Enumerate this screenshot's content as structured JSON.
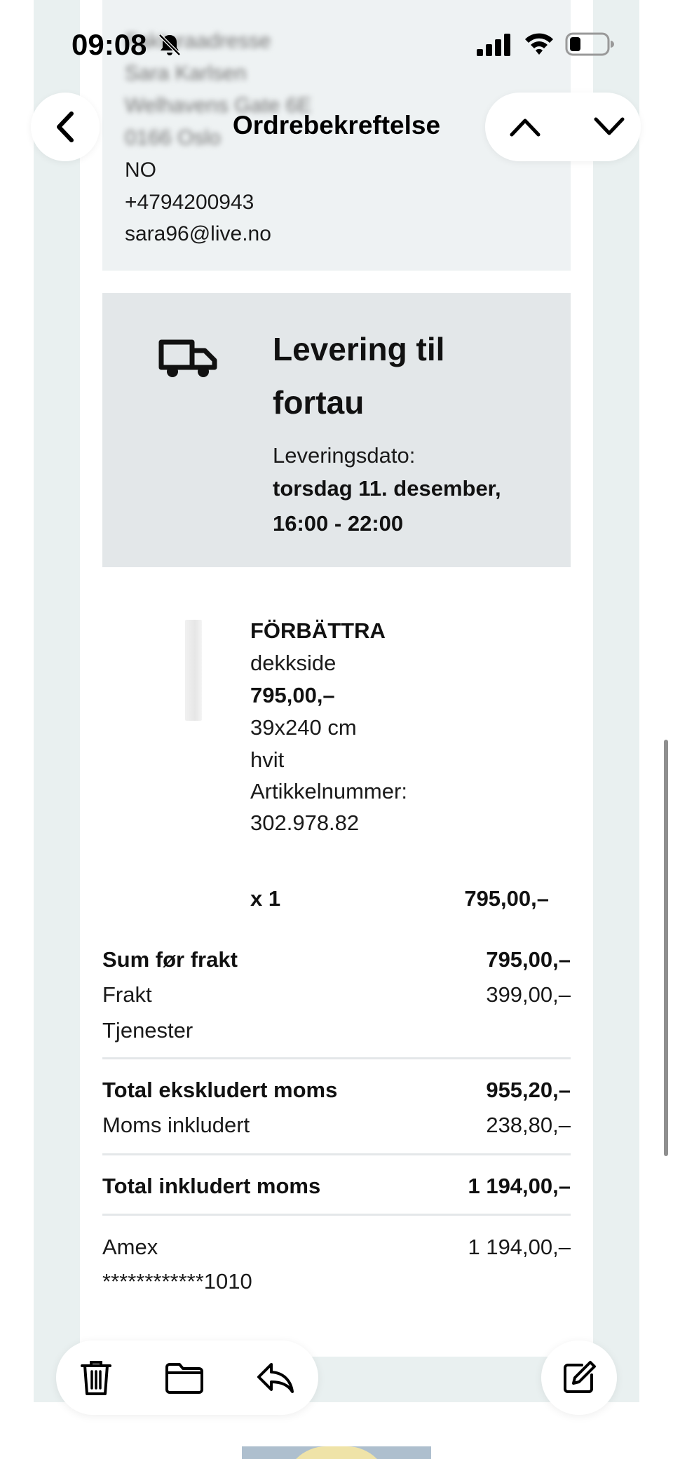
{
  "status_bar": {
    "time": "09:08"
  },
  "nav": {
    "title": "Ordrebekreftelse"
  },
  "address": {
    "heading": "Faktura­adresse",
    "name": "Sara Karlsen",
    "street": "Welhavens Gate 6E",
    "postal": "0166 Oslo",
    "country": "NO",
    "phone": "+4794200943",
    "email": "sara96@live.no"
  },
  "delivery": {
    "title": "Levering til fortau",
    "date_label": "Leveringsdato:",
    "date_value": "torsdag 11. desember, 16:00 - 22:00"
  },
  "product": {
    "name": "FÖRBÄTTRA",
    "type": "dekkside",
    "price": "795,00,–",
    "size": "39x240 cm",
    "color": "hvit",
    "article_label": "Artikkelnummer:",
    "article_number": "302.978.82",
    "quantity": "x 1",
    "line_total": "795,00,–"
  },
  "summary": {
    "subtotal_label": "Sum før frakt",
    "subtotal_value": "795,00,–",
    "shipping_label": "Frakt",
    "shipping_value": "399,00,–",
    "services_label": "Tjenester",
    "total_ex_vat_label": "Total ekskludert moms",
    "total_ex_vat_value": "955,20,–",
    "vat_label": "Moms inkludert",
    "vat_value": "238,80,–",
    "total_inc_vat_label": "Total inkludert moms",
    "total_inc_vat_value": "1 194,00,–",
    "payment_method": "Amex",
    "payment_value": "1 194,00,–",
    "card_number": "************1010"
  },
  "icons": {
    "back": "chevron-left-icon",
    "prev": "chevron-up-icon",
    "next": "chevron-down-icon",
    "delete": "trash-icon",
    "move": "folder-icon",
    "reply": "reply-icon",
    "compose": "compose-icon",
    "truck": "delivery-truck-icon",
    "mute": "bell-slash-icon"
  },
  "colors": {
    "email_background": "#e9f0f0",
    "address_box": "#eef2f3",
    "delivery_box": "#e3e7e9",
    "divider": "#e4e7e9"
  }
}
